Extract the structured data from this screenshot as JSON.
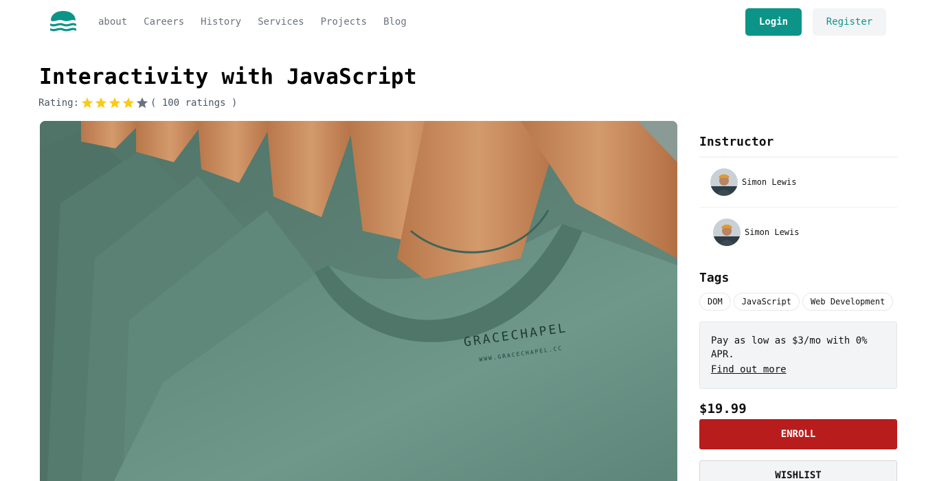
{
  "nav": {
    "logo_icon": "wave-logo-icon",
    "links": [
      "about",
      "Careers",
      "History",
      "Services",
      "Projects",
      "Blog"
    ],
    "login_label": "Login",
    "register_label": "Register"
  },
  "course": {
    "title": "Interactivity with JavaScript",
    "rating_label": "Rating:",
    "rating_value": 4,
    "rating_max": 5,
    "rating_count": "( 100 ratings )"
  },
  "hero_image": {
    "description_icon": "green-tshirts-photo",
    "label_line1": "GRACECHAPEL",
    "label_line2": "WWW.GRACECHAPEL.CC"
  },
  "sidebar": {
    "instructor_heading": "Instructor",
    "instructors": [
      {
        "name": "Simon Lewis"
      },
      {
        "name": "Simon Lewis"
      }
    ],
    "tags_heading": "Tags",
    "tags": [
      "DOM",
      "JavaScript",
      "Web Development"
    ],
    "promo_text": "Pay as low as $3/mo with 0% APR.",
    "promo_link": "Find out more",
    "price": "$19.99",
    "enroll_label": "ENROLL",
    "wishlist_label": "WISHLIST"
  },
  "colors": {
    "brand": "#0d9488",
    "star_filled": "#facc15",
    "star_empty": "#6b7280",
    "enroll": "#b91c1c"
  }
}
